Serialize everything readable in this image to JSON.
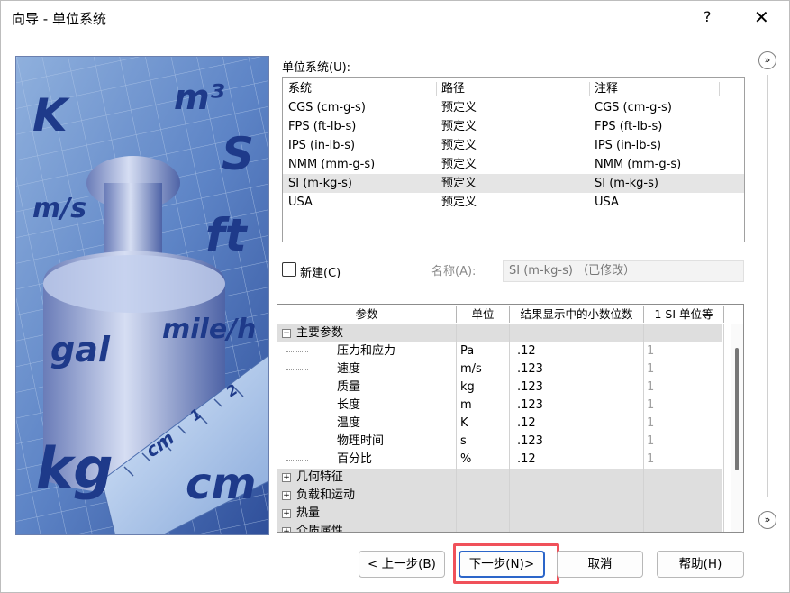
{
  "window": {
    "title": "向导 - 单位系统",
    "help_glyph": "?",
    "close_glyph": "✕"
  },
  "illustration": {
    "units": [
      "K",
      "m³",
      "S",
      "m/s",
      "ft",
      "gal",
      "mile/h",
      "kg",
      "cm"
    ],
    "ruler": {
      "label": "cm",
      "ticks": [
        "1",
        "2"
      ]
    }
  },
  "unit_systems": {
    "label": "单位系统(U):",
    "columns": [
      "系统",
      "路径",
      "注释"
    ],
    "rows": [
      {
        "system": "CGS (cm-g-s)",
        "path": "预定义",
        "note": "CGS (cm-g-s)"
      },
      {
        "system": "FPS (ft-lb-s)",
        "path": "预定义",
        "note": "FPS (ft-lb-s)"
      },
      {
        "system": "IPS (in-lb-s)",
        "path": "预定义",
        "note": "IPS (in-lb-s)"
      },
      {
        "system": "NMM (mm-g-s)",
        "path": "预定义",
        "note": "NMM (mm-g-s)"
      },
      {
        "system": "SI (m-kg-s)",
        "path": "预定义",
        "note": "SI (m-kg-s)"
      },
      {
        "system": "USA",
        "path": "预定义",
        "note": "USA"
      }
    ],
    "selected_row": "SI (m-kg-s)"
  },
  "new_system": {
    "label": "新建(C)",
    "checked": false,
    "name_label": "名称(A):",
    "name_value": "SI (m-kg-s) （已修改）"
  },
  "parameters": {
    "columns": [
      "参数",
      "单位",
      "结果显示中的小数位数",
      "1 SI 单位等"
    ],
    "groups": [
      {
        "name": "主要参数",
        "expander": "−",
        "items": [
          {
            "name": "压力和应力",
            "unit": "Pa",
            "decimals": ".12",
            "si": "1"
          },
          {
            "name": "速度",
            "unit": "m/s",
            "decimals": ".123",
            "si": "1"
          },
          {
            "name": "质量",
            "unit": "kg",
            "decimals": ".123",
            "si": "1"
          },
          {
            "name": "长度",
            "unit": "m",
            "decimals": ".123",
            "si": "1"
          },
          {
            "name": "温度",
            "unit": "K",
            "decimals": ".12",
            "si": "1"
          },
          {
            "name": "物理时间",
            "unit": "s",
            "decimals": ".123",
            "si": "1"
          },
          {
            "name": "百分比",
            "unit": "%",
            "decimals": ".12",
            "si": "1"
          }
        ]
      },
      {
        "name": "几何特征",
        "expander": "+"
      },
      {
        "name": "负载和运动",
        "expander": "+"
      },
      {
        "name": "热量",
        "expander": "+"
      },
      {
        "name": "介质属性",
        "expander": "+"
      }
    ]
  },
  "side_nav": {
    "up": "»",
    "down": "»"
  },
  "buttons": {
    "back": "< 上一步(B)",
    "next": "下一步(N)>",
    "cancel": "取消",
    "help": "帮助(H)"
  },
  "colors": {
    "illustration_bg": "#3d5ea8",
    "highlight": "#f0515a",
    "selection": "#e5e5e5",
    "group_row": "#dedede",
    "primary_border": "#2b65c9"
  }
}
